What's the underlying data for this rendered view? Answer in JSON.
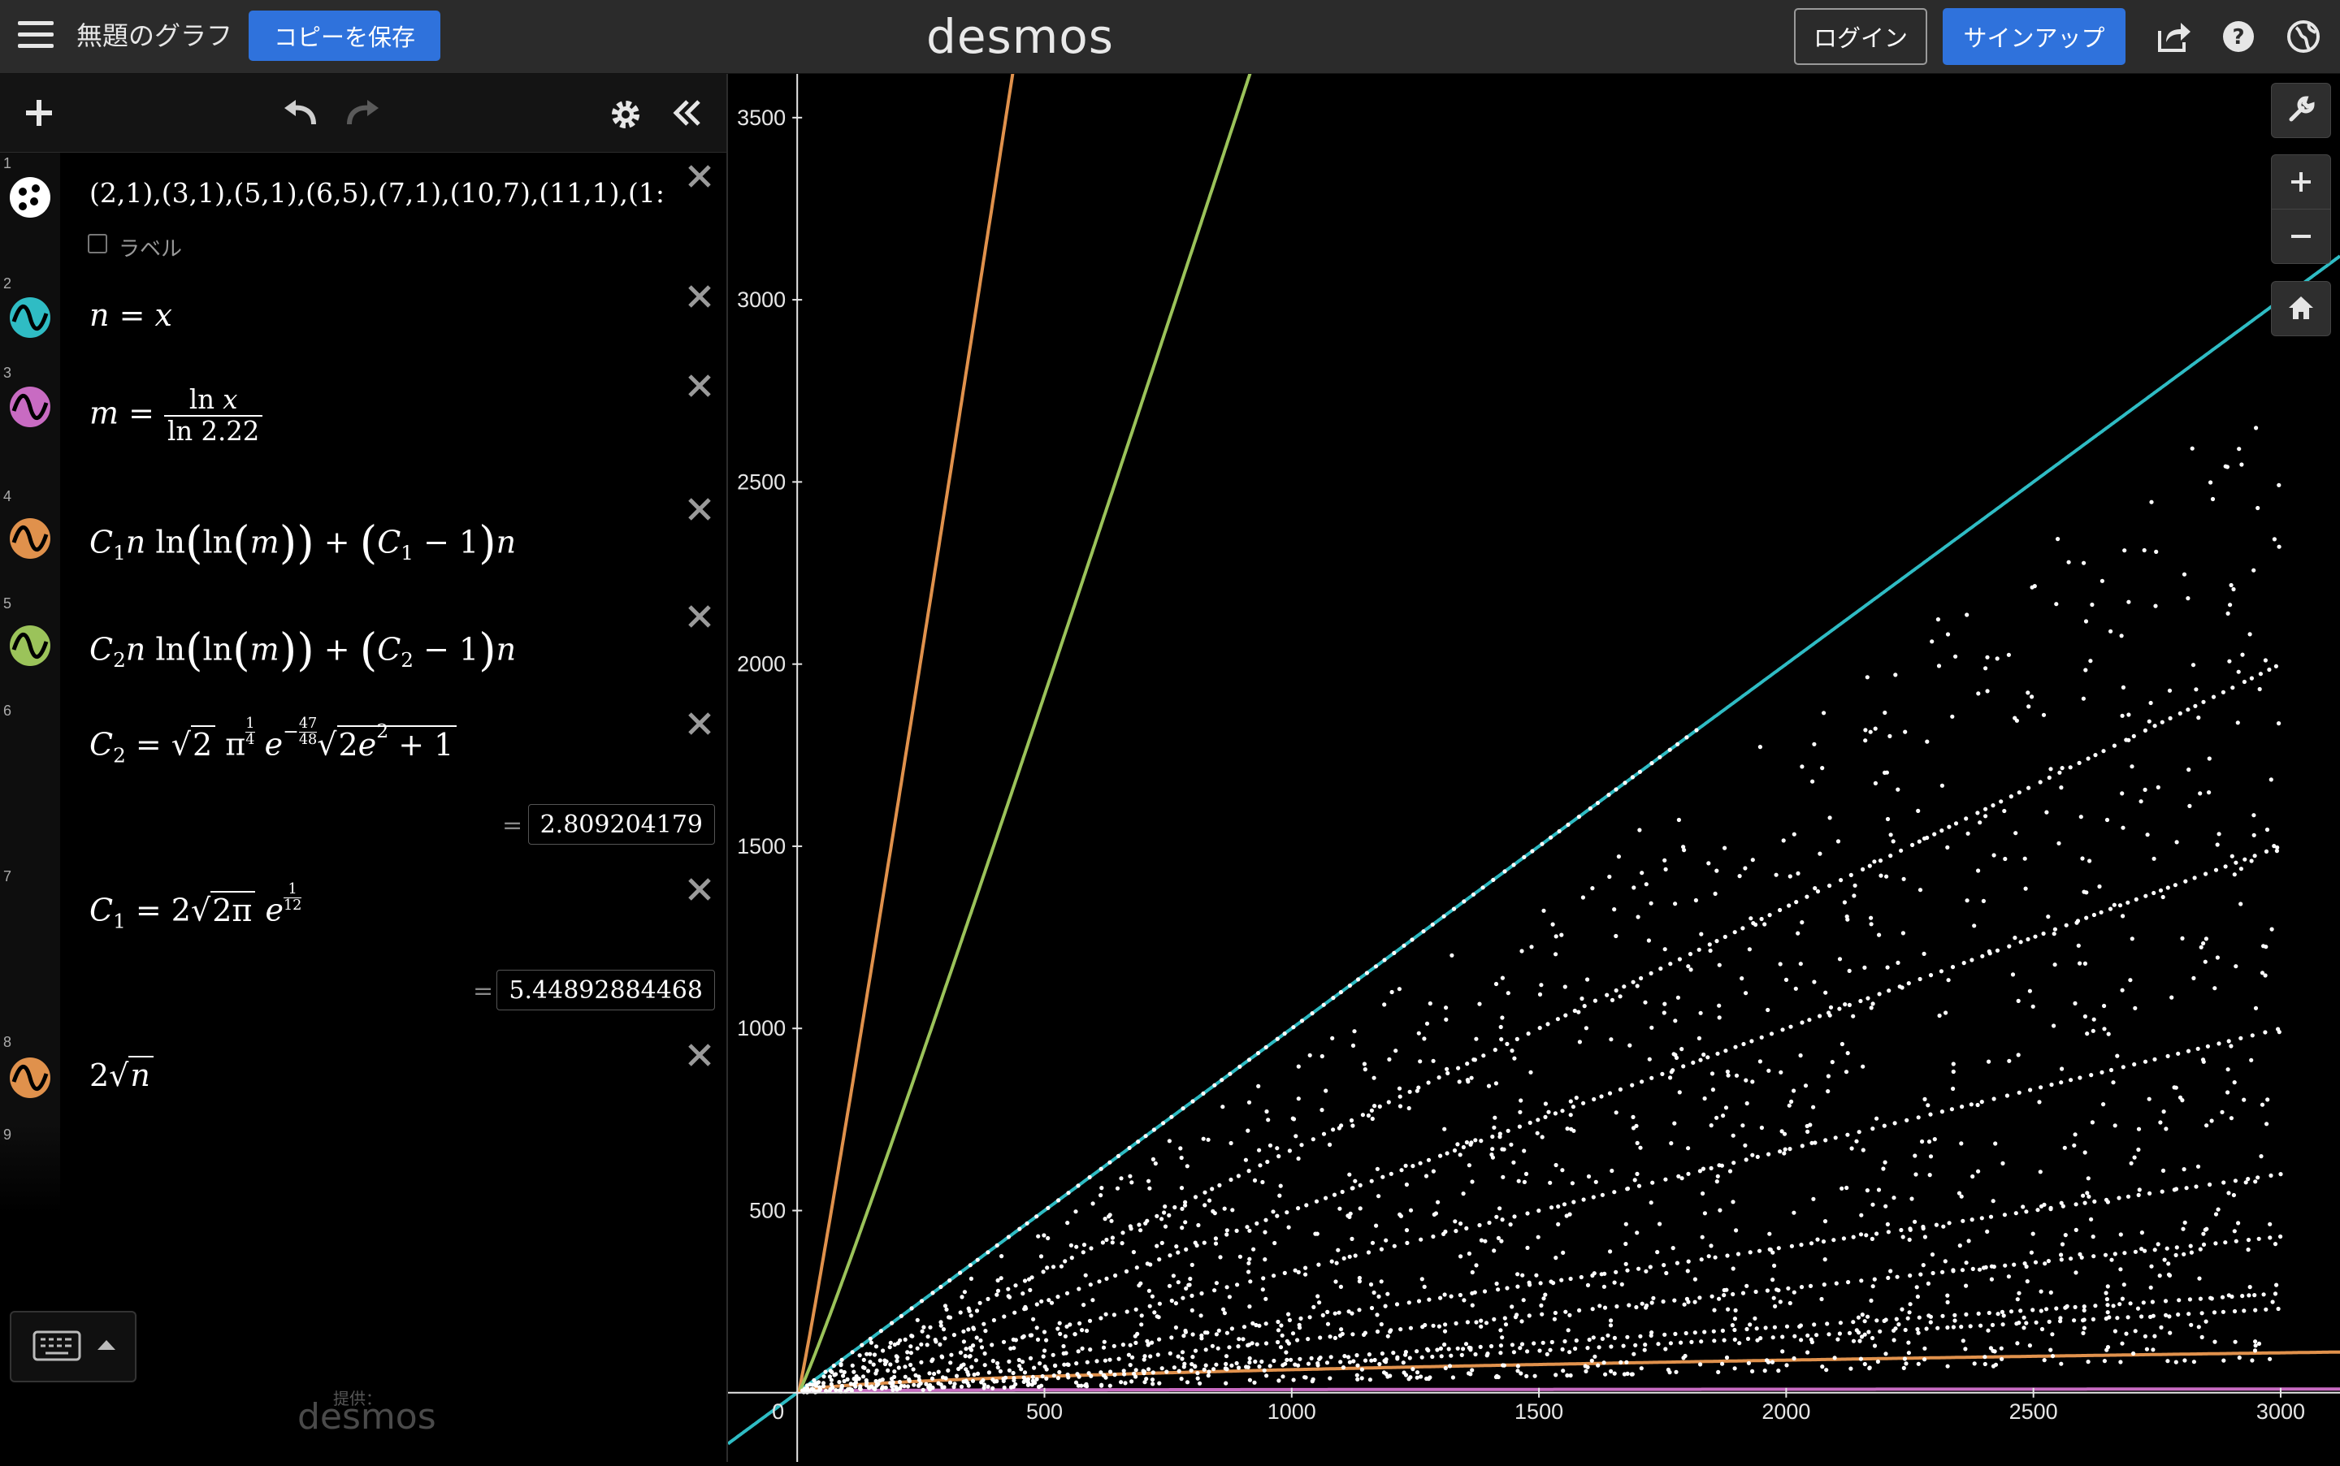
{
  "header": {
    "graph_title": "無題のグラフ",
    "save_label": "コピーを保存",
    "logo_text": "desmos",
    "login_label": "ログイン",
    "signup_label": "サインアップ"
  },
  "expressions": [
    {
      "id": 1,
      "num": "1",
      "type": "points",
      "color": "#ffffff",
      "text": "(2,1),(3,1),(5,1),(6,5),(7,1),(10,7),(11,1),(1:",
      "label_checkbox": "ラベル"
    },
    {
      "id": 2,
      "num": "2",
      "type": "curve",
      "color": "#2fbcc4"
    },
    {
      "id": 3,
      "num": "3",
      "type": "curve",
      "color": "#c86bc2"
    },
    {
      "id": 4,
      "num": "4",
      "type": "curve",
      "color": "#e0914c"
    },
    {
      "id": 5,
      "num": "5",
      "type": "curve",
      "color": "#9bc35a"
    },
    {
      "id": 6,
      "num": "6",
      "type": "constant",
      "result": "2.809204179"
    },
    {
      "id": 7,
      "num": "7",
      "type": "constant",
      "result": "5.44892884468"
    },
    {
      "id": 8,
      "num": "8",
      "type": "curve",
      "color": "#e0914c"
    },
    {
      "id": 9,
      "num": "9",
      "type": "empty"
    }
  ],
  "footer": {
    "powered_by": "提供：",
    "powered_logo": "desmos"
  },
  "graph": {
    "x_ticks": [
      "500",
      "1000",
      "1500",
      "2000",
      "2500",
      "3000"
    ],
    "y_ticks": [
      "500",
      "1000",
      "1500",
      "2000",
      "2500",
      "3000",
      "3500"
    ],
    "origin_label": "0",
    "background": "#000000"
  },
  "chart_data": {
    "type": "scatter",
    "xlim": [
      -140,
      3120
    ],
    "ylim": [
      -190,
      3620
    ],
    "grid": false,
    "series": [
      {
        "kind": "points",
        "color": "#ffffff",
        "rays": [
          {
            "slope": 1.0,
            "xmax": 1820
          },
          {
            "slope": 0.6667,
            "xmax": 3000
          },
          {
            "slope": 0.5,
            "xmax": 3000
          },
          {
            "slope": 0.3333,
            "xmax": 3000
          },
          {
            "slope": 0.2,
            "xmax": 3000
          },
          {
            "slope": 0.1429,
            "xmax": 3000
          },
          {
            "slope": 0.0909,
            "xmax": 3000
          },
          {
            "slope": 0.0769,
            "xmax": 3000
          }
        ],
        "scatter_region": {
          "min_slope": 0.03,
          "max_slope": 0.92
        }
      },
      {
        "kind": "function",
        "expr": "n = x",
        "color": "#2fbcc4"
      },
      {
        "kind": "function",
        "expr": "m = ln x / ln 2.22",
        "color": "#c86bc2"
      },
      {
        "kind": "function",
        "expr": "C1 n ln(ln(m)) + (C1 - 1) n",
        "color": "#e0914c"
      },
      {
        "kind": "function",
        "expr": "C2 n ln(ln(m)) + (C2 - 1) n",
        "color": "#9bc35a"
      },
      {
        "kind": "function",
        "expr": "2 sqrt(n)",
        "color": "#e0914c"
      }
    ]
  }
}
